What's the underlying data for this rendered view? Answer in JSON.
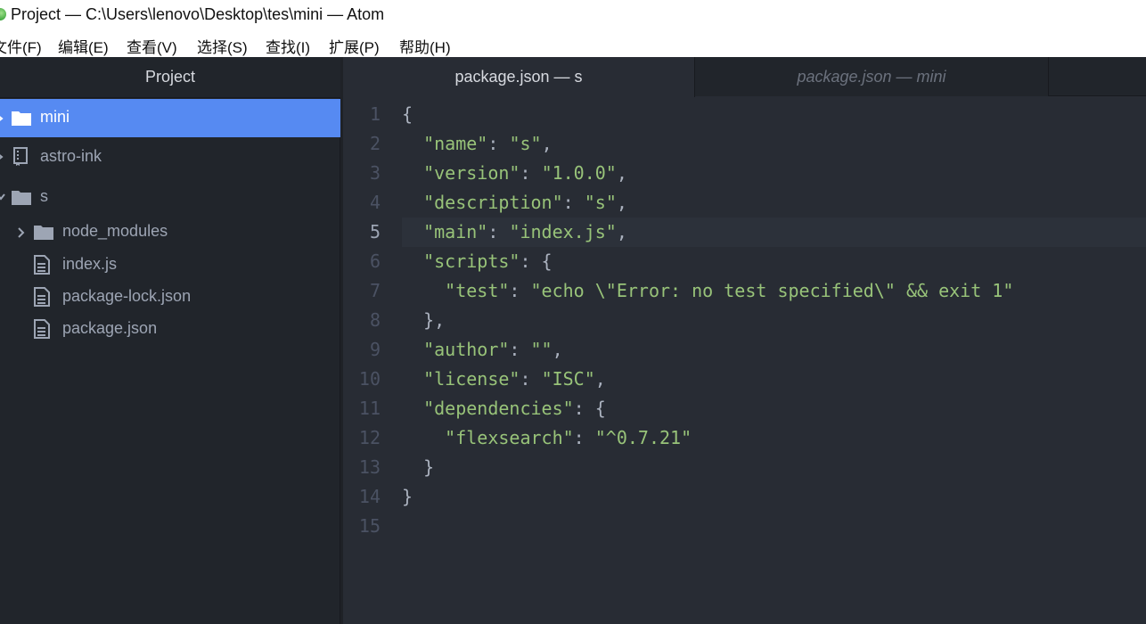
{
  "window": {
    "title": "Project — C:\\Users\\lenovo\\Desktop\\tes\\mini — Atom"
  },
  "menu": [
    {
      "label": "文件(F)"
    },
    {
      "label": "编辑(E)"
    },
    {
      "label": "查看(V)"
    },
    {
      "label": "选择(S)"
    },
    {
      "label": "查找(I)"
    },
    {
      "label": "扩展(P)"
    },
    {
      "label": "帮助(H)"
    }
  ],
  "tree": {
    "header": "Project",
    "items": [
      {
        "label": "mini",
        "icon": "folder-icon",
        "selected": true
      },
      {
        "label": "astro-ink",
        "icon": "repo-icon"
      },
      {
        "label": "s",
        "icon": "folder-icon",
        "expanded": true
      },
      {
        "label": "node_modules",
        "icon": "folder-icon"
      },
      {
        "label": "index.js",
        "icon": "file-icon"
      },
      {
        "label": "package-lock.json",
        "icon": "file-icon"
      },
      {
        "label": "package.json",
        "icon": "file-icon"
      }
    ]
  },
  "tabs": [
    {
      "label": "package.json — s",
      "active": true
    },
    {
      "label": "package.json — mini",
      "active": false
    }
  ],
  "editor": {
    "cursor_line": 5,
    "lines": [
      {
        "num": "1",
        "text": "{"
      },
      {
        "num": "2",
        "text": "  \"name\": \"s\","
      },
      {
        "num": "3",
        "text": "  \"version\": \"1.0.0\","
      },
      {
        "num": "4",
        "text": "  \"description\": \"s\","
      },
      {
        "num": "5",
        "text": "  \"main\": \"index.js\","
      },
      {
        "num": "6",
        "text": "  \"scripts\": {"
      },
      {
        "num": "7",
        "text": "    \"test\": \"echo \\\"Error: no test specified\\\" && exit 1\""
      },
      {
        "num": "8",
        "text": "  },"
      },
      {
        "num": "9",
        "text": "  \"author\": \"\","
      },
      {
        "num": "10",
        "text": "  \"license\": \"ISC\","
      },
      {
        "num": "11",
        "text": "  \"dependencies\": {"
      },
      {
        "num": "12",
        "text": "    \"flexsearch\": \"^0.7.21\""
      },
      {
        "num": "13",
        "text": "  }"
      },
      {
        "num": "14",
        "text": "}"
      },
      {
        "num": "15",
        "text": ""
      }
    ]
  },
  "colors": {
    "selection": "#568af2",
    "string": "#98c379",
    "editor_bg": "#282c34",
    "panel_bg": "#21252b"
  }
}
